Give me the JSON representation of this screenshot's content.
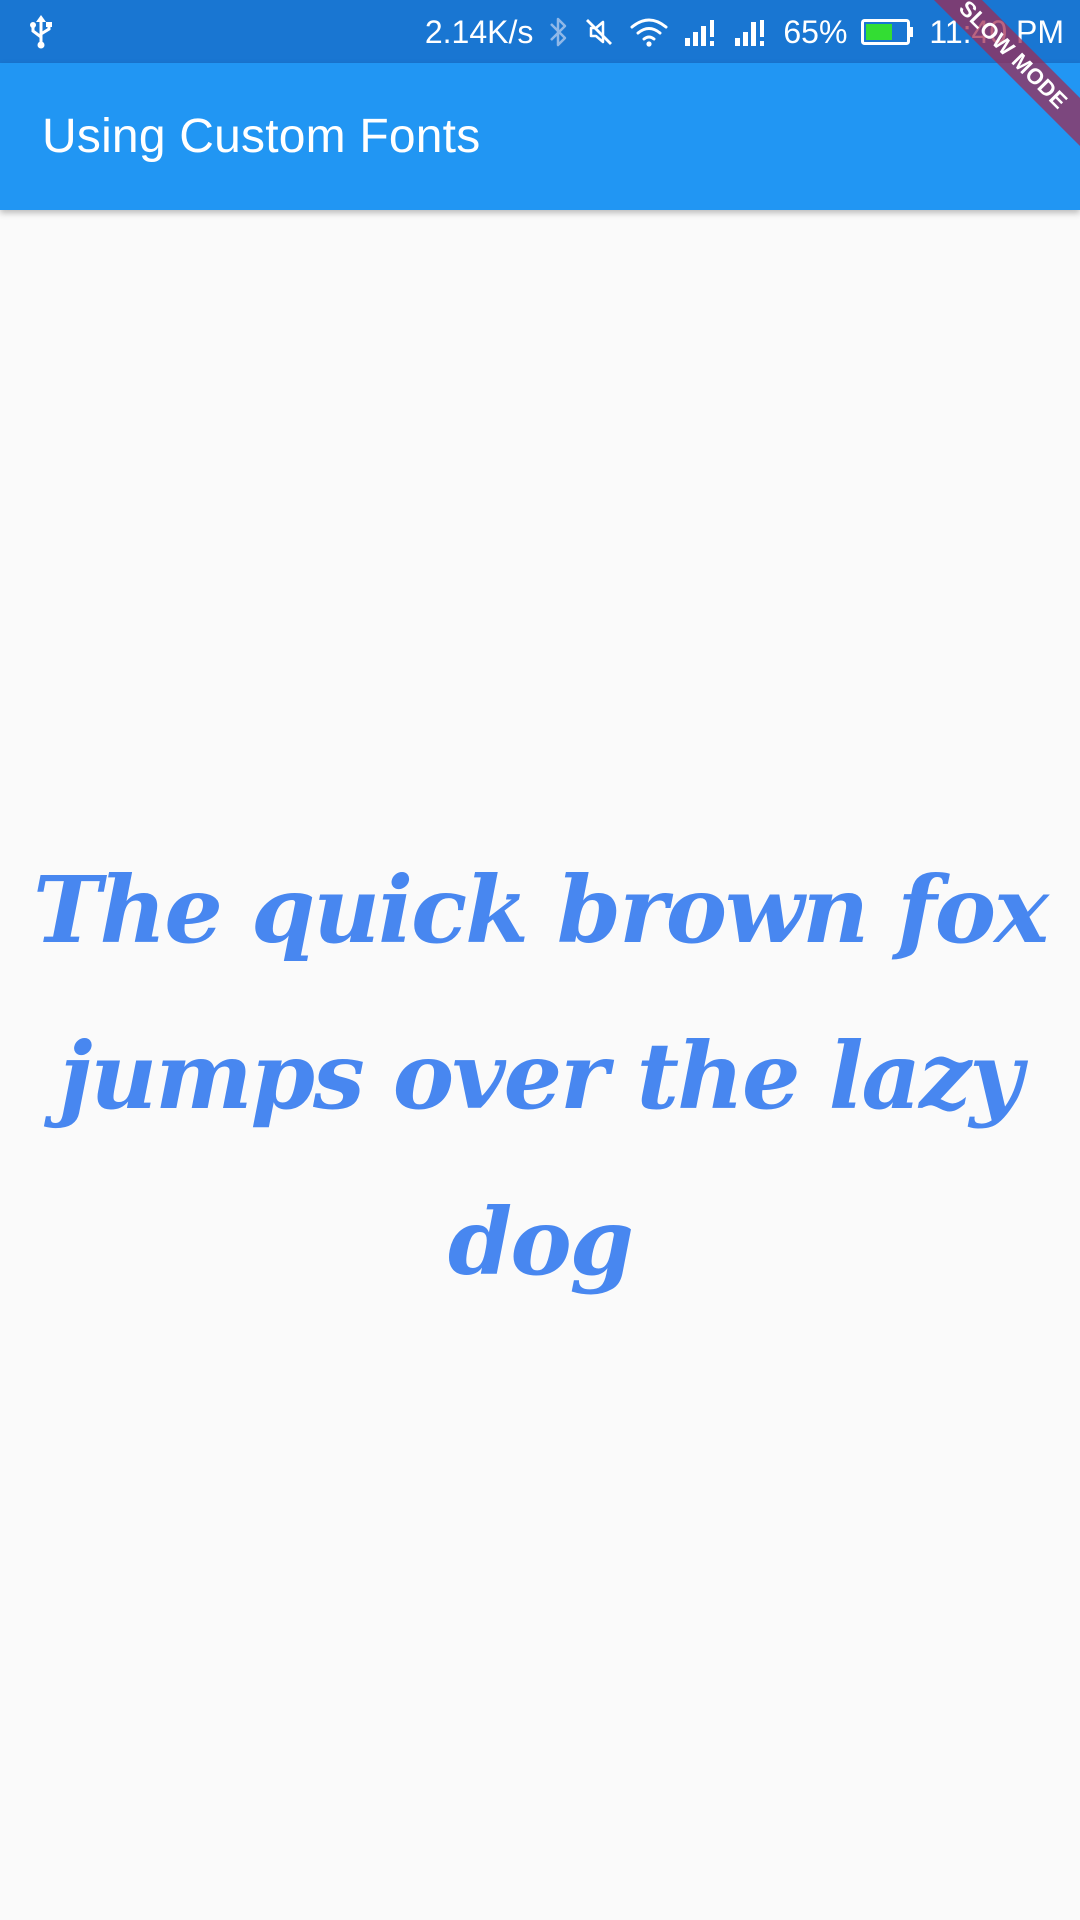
{
  "status_bar": {
    "network_speed": "2.14K/s",
    "battery_percent": "65%",
    "time": "11:40 PM",
    "battery_level": 0.65,
    "icons": [
      "usb-icon",
      "bluetooth-icon",
      "mute-icon",
      "wifi-icon",
      "signal-icon",
      "signal-icon"
    ]
  },
  "app_bar": {
    "title": "Using Custom Fonts"
  },
  "body": {
    "text": "The quick brown fox jumps over the lazy dog"
  },
  "debug_banner": {
    "label": "SLOW MODE"
  },
  "colors": {
    "status_bar": "#1976d2",
    "app_bar": "#2196f3",
    "text": "#4887f0",
    "background": "#fafafa",
    "battery_fill": "#33dd33"
  }
}
